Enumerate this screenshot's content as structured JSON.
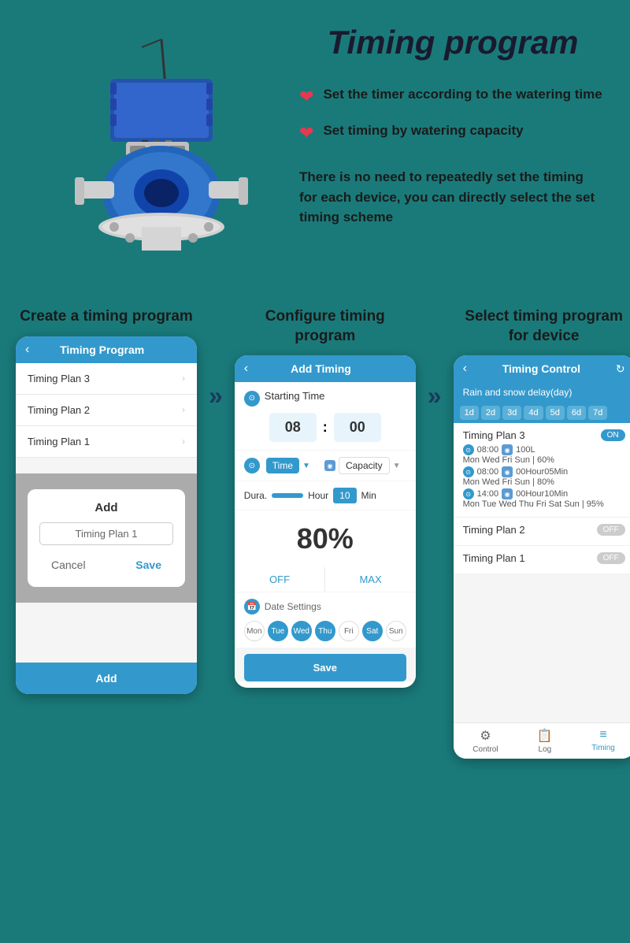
{
  "page": {
    "title": "Timing program",
    "background_color": "#1a7a7a"
  },
  "features": {
    "item1": "Set the timer according to the watering time",
    "item2": "Set timing by watering capacity",
    "description": "There is no need to repeatedly set the timing for each device, you can directly select the set timing scheme"
  },
  "steps": [
    {
      "title": "Create a timing program",
      "phone": {
        "header": "Timing Program",
        "list": [
          "Timing Plan 3",
          "Timing Plan 2",
          "Timing Plan 1"
        ],
        "modal_title": "Add",
        "modal_input": "Timing Plan 1",
        "cancel": "Cancel",
        "save": "Save",
        "bottom_btn": "Add"
      }
    },
    {
      "title": "Configure timing program",
      "phone": {
        "header": "Add Timing",
        "starting_time_label": "Starting Time",
        "hour": "08",
        "minute": "00",
        "time_label": "Time",
        "capacity_label": "Capacity",
        "dura_label": "Dura.",
        "hour_label": "Hour",
        "min_value": "10",
        "min_label": "Min",
        "percent": "80%",
        "off_label": "OFF",
        "max_label": "MAX",
        "date_settings_label": "Date Settings",
        "days": [
          "Mon",
          "Tue",
          "Wed",
          "Thu",
          "Fri",
          "Sat",
          "Sun"
        ],
        "active_days": [
          1,
          2,
          3,
          5
        ],
        "save_btn": "Save"
      }
    },
    {
      "title": "Select timing program for device",
      "phone": {
        "header": "Timing Control",
        "delay_label": "Rain and snow delay(day)",
        "day_tabs": [
          "1d",
          "2d",
          "3d",
          "4d",
          "5d",
          "6d",
          "7d"
        ],
        "plans": [
          {
            "name": "Timing Plan 3",
            "toggle": "ON",
            "details": [
              {
                "time": "08:00",
                "cap": "100L",
                "schedule": "Mon Wed Fri Sun | 60%"
              },
              {
                "time": "08:00",
                "cap": "00Hour05Min",
                "schedule": "Mon Wed Fri Sun | 80%"
              },
              {
                "time": "14:00",
                "cap": "00Hour10Min",
                "schedule": "Mon Tue Wed Thu Fri Sat Sun | 95%"
              }
            ]
          },
          {
            "name": "Timing Plan 2",
            "toggle": "OFF"
          },
          {
            "name": "Timing Plan 1",
            "toggle": "OFF"
          }
        ],
        "nav": [
          "Control",
          "Log",
          "Timing"
        ]
      }
    }
  ]
}
